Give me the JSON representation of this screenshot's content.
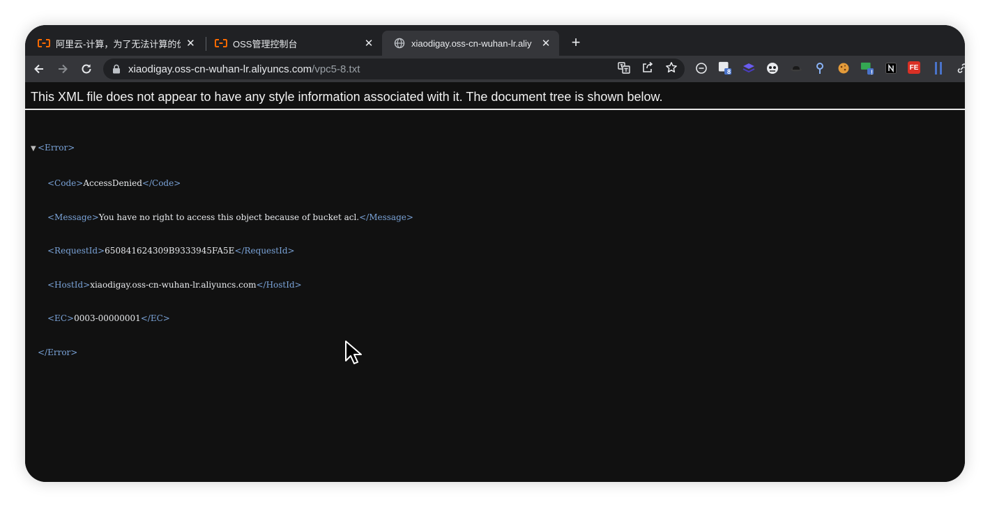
{
  "tabs": [
    {
      "title": "阿里云-计算，为了无法计算的价",
      "favicon": "aliyun-icon",
      "active": false
    },
    {
      "title": "OSS管理控制台",
      "favicon": "aliyun-icon",
      "active": false
    },
    {
      "title": "xiaodigay.oss-cn-wuhan-lr.aliy",
      "favicon": "globe-icon",
      "active": true
    }
  ],
  "toolbar": {
    "url_host": "xiaodigay.oss-cn-wuhan-lr.aliyuncs.com",
    "url_path": "/vpc5-8.txt"
  },
  "extensions": {
    "badge_count": "8",
    "badge_alert": "!",
    "fe_label": "FE"
  },
  "page": {
    "header": "This XML file does not appear to have any style information associated with it. The document tree is shown below.",
    "xml": {
      "root_open": "<Error>",
      "root_close": "</Error>",
      "code_open": "<Code>",
      "code_value": "AccessDenied",
      "code_close": "</Code>",
      "message_open": "<Message>",
      "message_value": "You have no right to access this object because of bucket acl.",
      "message_close": "</Message>",
      "requestid_open": "<RequestId>",
      "requestid_value": "650841624309B9333945FA5E",
      "requestid_close": "</RequestId>",
      "hostid_open": "<HostId>",
      "hostid_value": "xiaodigay.oss-cn-wuhan-lr.aliyuncs.com",
      "hostid_close": "</HostId>",
      "ec_open": "<EC>",
      "ec_value": "0003-00000001",
      "ec_close": "</EC>"
    }
  },
  "colors": {
    "tabstrip": "#202124",
    "toolbar": "#35363a",
    "page_bg": "#111111",
    "xml_tag": "#7aa3d8",
    "aliyun_orange": "#ff6a00"
  }
}
